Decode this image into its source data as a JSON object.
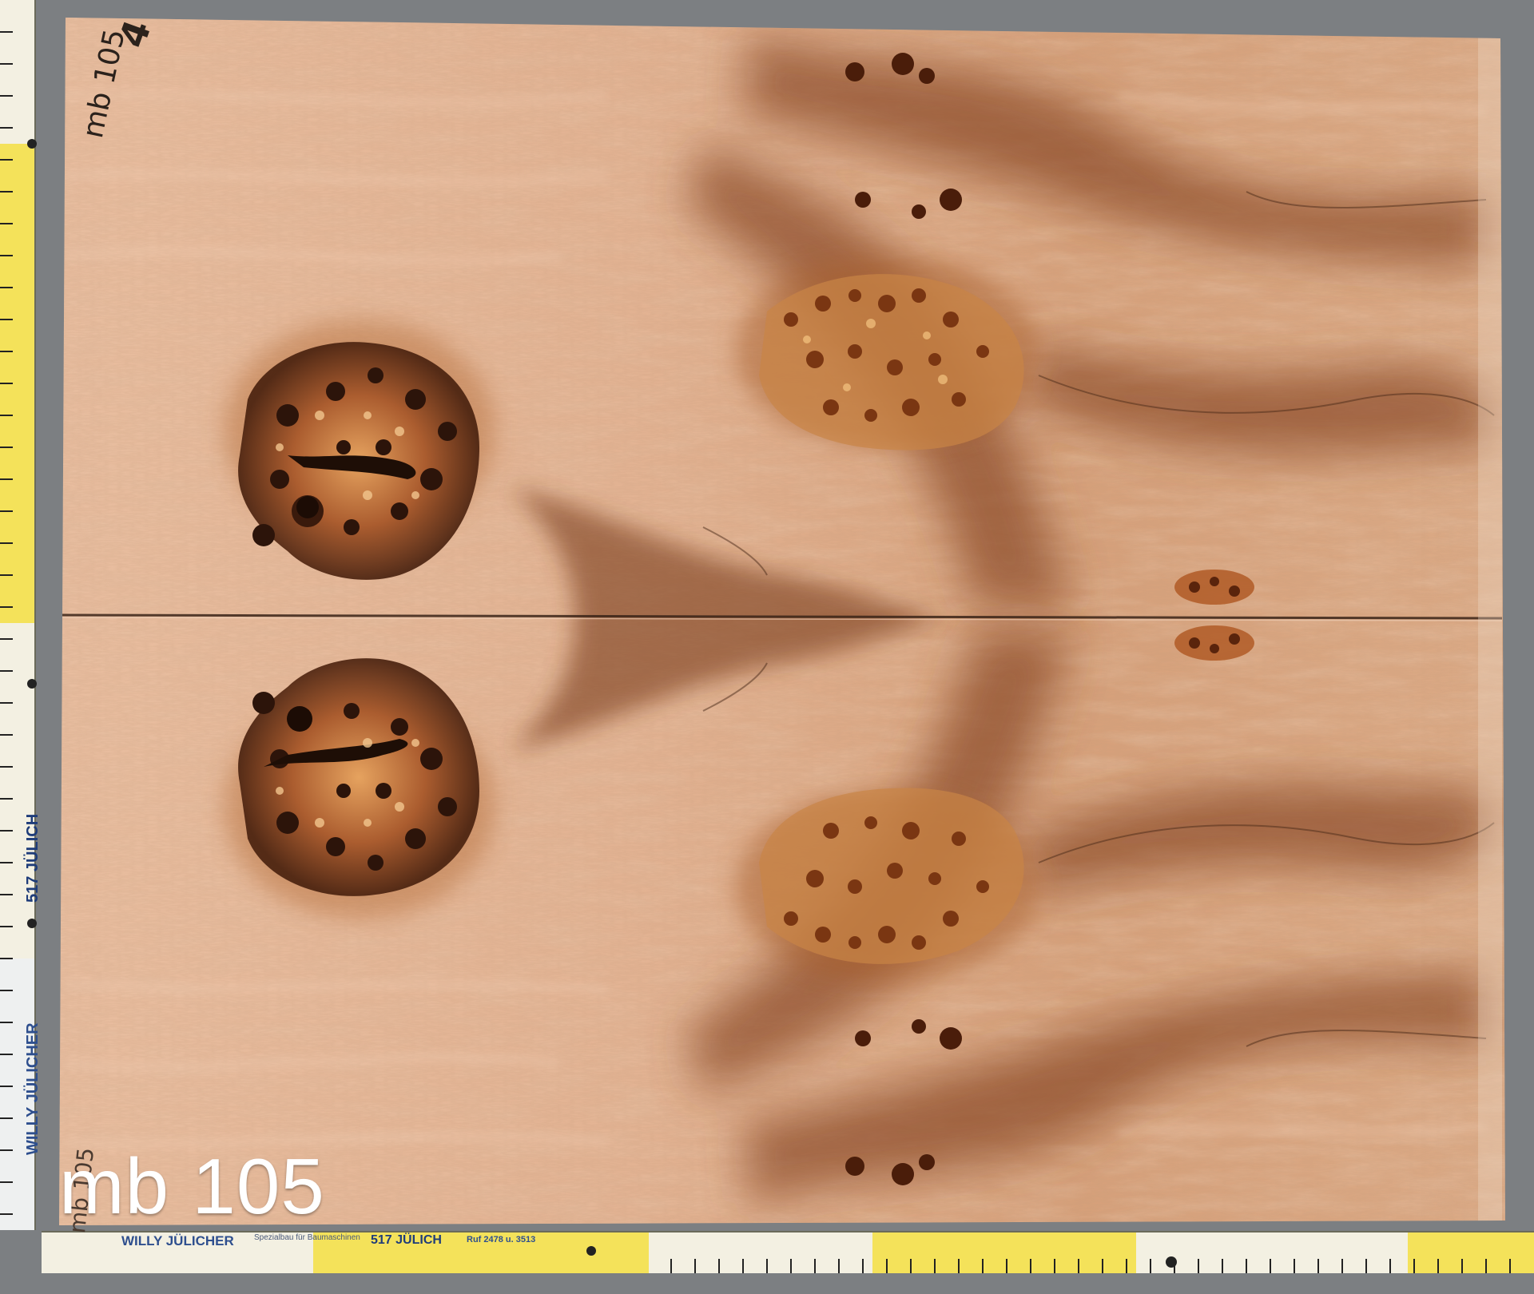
{
  "caption": "mb 105",
  "pencil_marks": {
    "top_id": "mb 105",
    "top_digit": "4",
    "bottom_id": "mb 105"
  },
  "rulers": {
    "vertical": {
      "brand": "WILLY JÜLICHER",
      "city_text": "517 JÜLICH"
    },
    "horizontal": {
      "brand": "WILLY JÜLICHER",
      "tagline": "Spezialbau für Baumaschinen",
      "city_text": "517 JÜLICH",
      "phone": "Ruf 2478 u. 3513"
    }
  },
  "colors": {
    "background": "#7c7f82",
    "wood_light": "#e3b596",
    "wood_mid": "#c88a5e",
    "wood_dark": "#5a2f1c",
    "ruler_yellow": "#f4e25a",
    "ruler_white": "#f3f0e2"
  }
}
